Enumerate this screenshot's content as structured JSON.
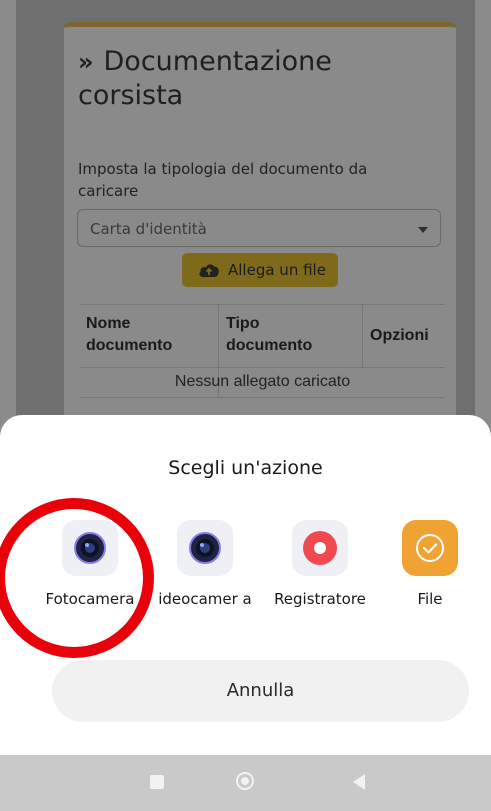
{
  "background_page": {
    "card_title": "Documentazione corsista",
    "hint": "Imposta la tipologia del documento da caricare",
    "document_type_select": {
      "selected": "Carta d'identità"
    },
    "attach_button": "Allega un file",
    "table": {
      "headers": [
        "Nome documento",
        "Tipo documento",
        "Opzioni"
      ],
      "empty_message": "Nessun allegato caricato"
    }
  },
  "sheet": {
    "title": "Scegli un'azione",
    "actions": [
      {
        "label": "Fotocamera",
        "icon": "camera-icon"
      },
      {
        "label": "ideocamer a",
        "icon": "videocamera-icon"
      },
      {
        "label": "Registratore",
        "icon": "recorder-icon"
      },
      {
        "label": "File",
        "icon": "file-icon"
      }
    ],
    "cancel": "Annulla"
  },
  "nav": {
    "icons": [
      "recents-square-icon",
      "home-circle-icon",
      "back-triangle-icon"
    ]
  },
  "colors": {
    "annotation": "#e8000b",
    "accent_orange": "#f0a233",
    "recorder_red": "#f04a4f"
  }
}
